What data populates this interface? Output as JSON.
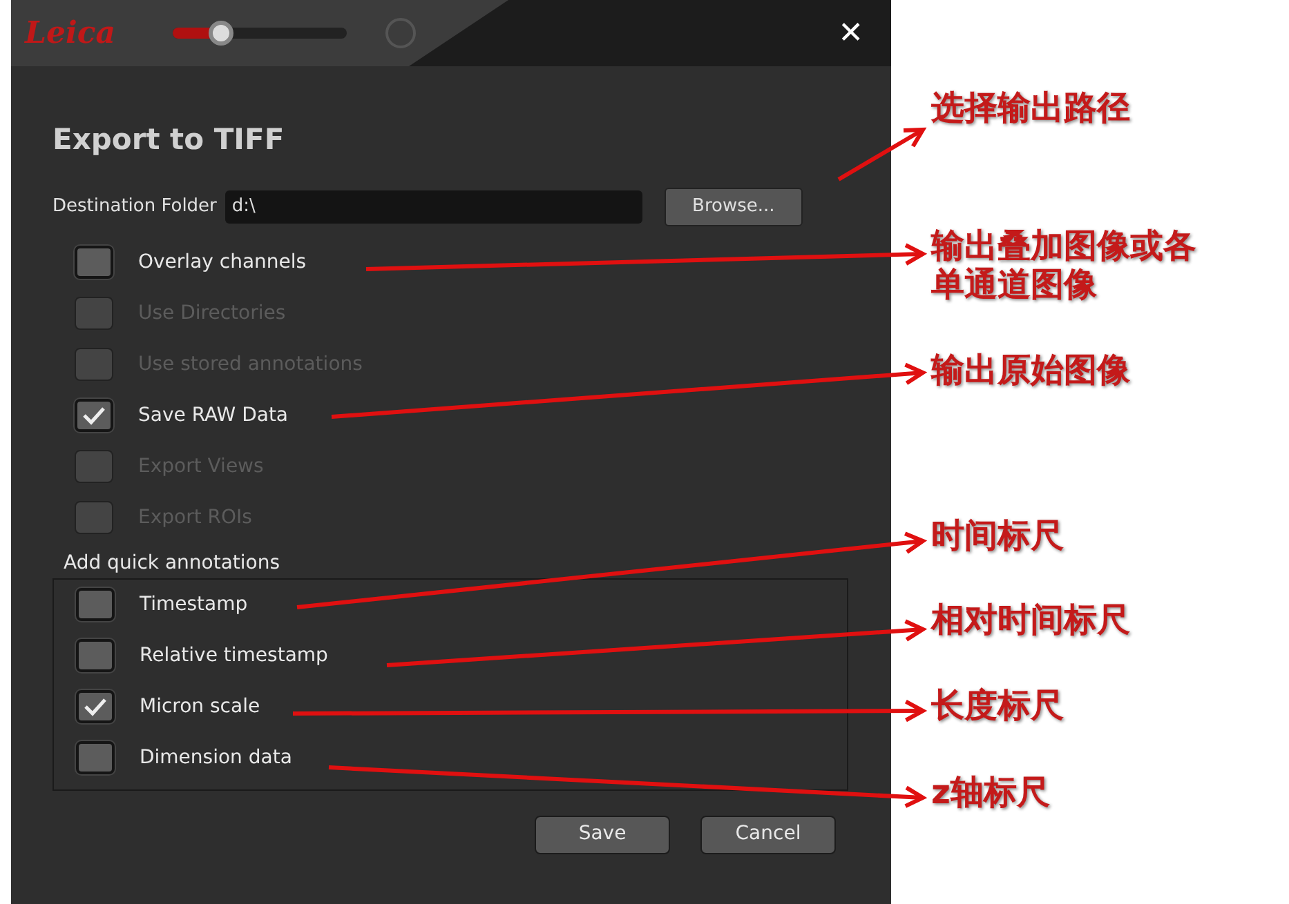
{
  "window": {
    "logo": "Leica",
    "zoom_slider": {
      "level": 0.28
    },
    "close": "✕"
  },
  "dialog": {
    "title": "Export to TIFF",
    "destination": {
      "label": "Destination Folder",
      "value": "d:\\",
      "browse": "Browse..."
    },
    "options": [
      {
        "label": "Overlay channels",
        "checked": false,
        "disabled": false
      },
      {
        "label": "Use Directories",
        "checked": false,
        "disabled": true
      },
      {
        "label": "Use stored annotations",
        "checked": false,
        "disabled": true
      },
      {
        "label": "Save RAW Data",
        "checked": true,
        "disabled": false
      },
      {
        "label": "Export Views",
        "checked": false,
        "disabled": true
      },
      {
        "label": "Export ROIs",
        "checked": false,
        "disabled": true
      }
    ],
    "quick_annotations": {
      "label": "Add quick annotations",
      "options": [
        {
          "label": "Timestamp",
          "checked": false,
          "disabled": false
        },
        {
          "label": "Relative timestamp",
          "checked": false,
          "disabled": false
        },
        {
          "label": "Micron scale",
          "checked": true,
          "disabled": false
        },
        {
          "label": "Dimension data",
          "checked": false,
          "disabled": false
        }
      ]
    },
    "buttons": [
      "Save",
      "Cancel"
    ]
  },
  "annotations": [
    {
      "text": "选择输出路径"
    },
    {
      "text": "输出叠加图像或各单通道图像"
    },
    {
      "text": "输出原始图像"
    },
    {
      "text": "时间标尺"
    },
    {
      "text": "相对时间标尺"
    },
    {
      "text": "长度标尺"
    },
    {
      "text": "z轴标尺"
    }
  ]
}
